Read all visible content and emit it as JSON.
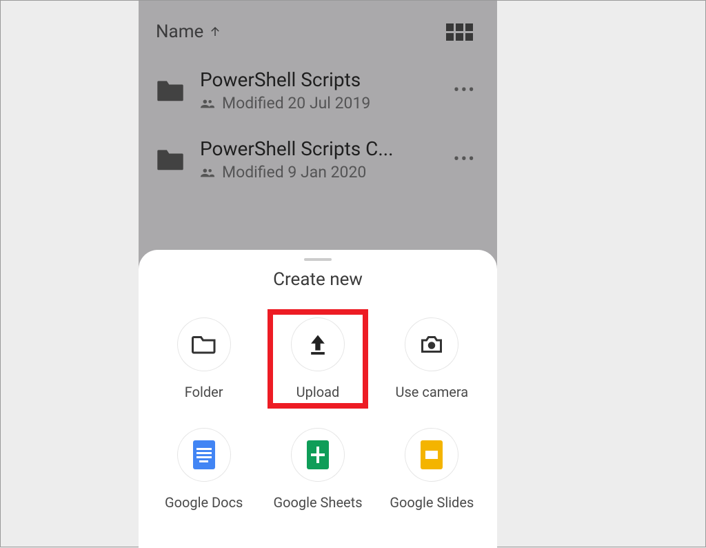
{
  "header": {
    "sort_label": "Name"
  },
  "files": [
    {
      "name": "PowerShell Scripts",
      "modified": "Modified 20 Jul 2019"
    },
    {
      "name": "PowerShell Scripts C...",
      "modified": "Modified 9 Jan 2020"
    }
  ],
  "sheet": {
    "title": "Create new",
    "actions": [
      {
        "label": "Folder",
        "icon": "folder"
      },
      {
        "label": "Upload",
        "icon": "upload",
        "highlighted": true
      },
      {
        "label": "Use camera",
        "icon": "camera"
      },
      {
        "label": "Google Docs",
        "icon": "docs"
      },
      {
        "label": "Google Sheets",
        "icon": "sheets"
      },
      {
        "label": "Google Slides",
        "icon": "slides"
      }
    ]
  }
}
